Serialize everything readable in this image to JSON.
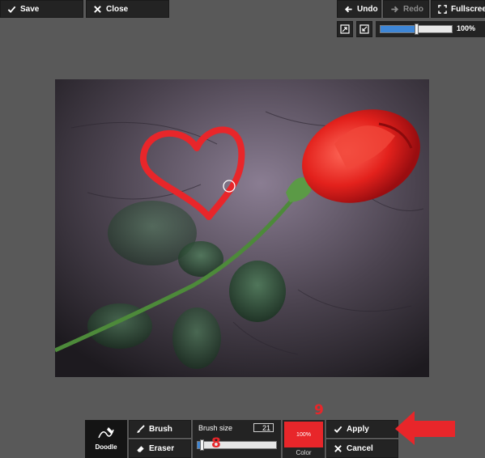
{
  "top_toolbar": {
    "save_label": "Save",
    "close_label": "Close",
    "undo_label": "Undo",
    "redo_label": "Redo",
    "fullscreen_label": "Fullscreen"
  },
  "zoom": {
    "value_label": "100%",
    "level": 0.5
  },
  "bottom_toolbar": {
    "doodle_label": "Doodle",
    "brush_label": "Brush",
    "eraser_label": "Eraser",
    "brush_size_label": "Brush size",
    "brush_size_value": "21",
    "brush_size_level": 0.05,
    "color_swatch_text": "100%",
    "color_label": "Color",
    "apply_label": "Apply",
    "cancel_label": "Cancel"
  },
  "annotations": {
    "marker_9": "9",
    "marker_8": "8"
  },
  "colors": {
    "brush_color": "#e8262a",
    "slider_fill": "#3e86d6",
    "background": "#595959",
    "button_bg": "#232323",
    "annotation": "#e8262a"
  },
  "icons": {
    "save": "check-icon",
    "close": "x-icon",
    "undo": "arrow-left-icon",
    "redo": "arrow-right-icon",
    "fullscreen": "expand-icon",
    "fit": "fit-to-screen-icon",
    "actual_size": "actual-size-icon",
    "doodle": "doodle-pen-icon",
    "brush": "brush-icon",
    "eraser": "eraser-icon",
    "apply": "check-icon",
    "cancel": "x-icon"
  }
}
